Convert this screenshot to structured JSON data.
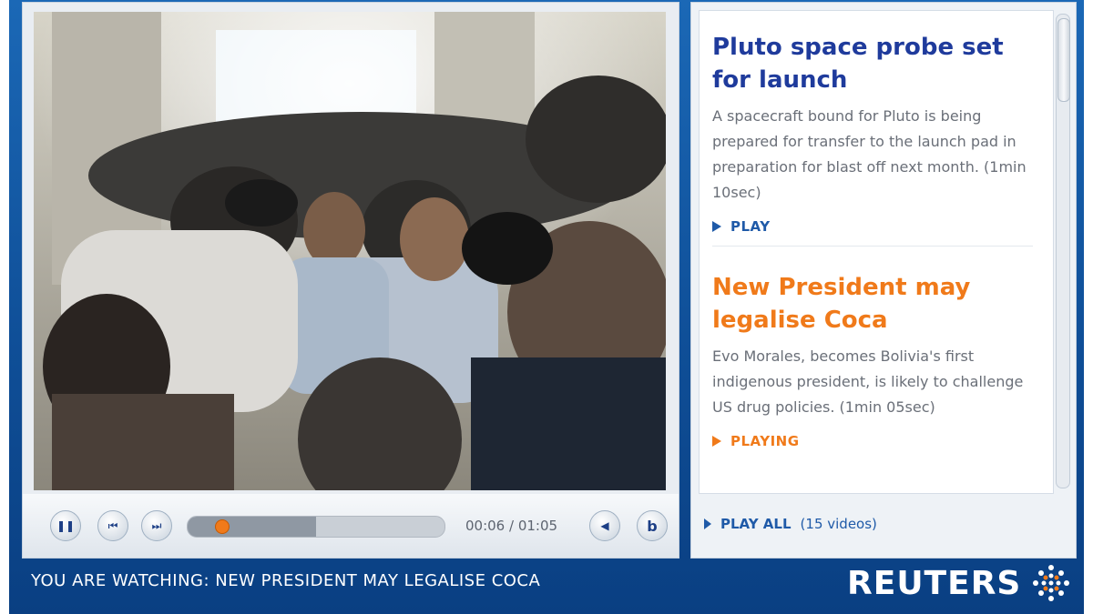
{
  "player": {
    "controls": {
      "pause": {
        "icon": "pause-icon",
        "glyph": "❚❚"
      },
      "prev": {
        "icon": "previous-icon",
        "glyph": "⏮"
      },
      "next": {
        "icon": "next-icon",
        "glyph": "⏭"
      },
      "volume": {
        "icon": "speaker-icon",
        "glyph": "◀"
      },
      "share": {
        "icon": "share-icon",
        "glyph": "b"
      }
    },
    "progress_fraction": 0.13,
    "buffered_fraction": 0.5,
    "time_display": "00:06 / 01:05"
  },
  "playlist": {
    "items": [
      {
        "title": "Pluto space probe set for launch",
        "description": "A spacecraft bound for Pluto is being prepared for transfer to the launch pad in preparation for blast off next month.  (1min 10sec)",
        "action": "PLAY",
        "color": "#1f3b9c"
      },
      {
        "title": "New President may legalise Coca",
        "description": "Evo Morales, becomes Bolivia's first indigenous president, is likely to challenge US drug policies.  (1min 05sec)",
        "action": "PLAYING",
        "color": "#f07a1a"
      }
    ],
    "play_all_label": "PLAY ALL",
    "play_all_count": "(15 videos)"
  },
  "now_watching": "YOU ARE WATCHING: NEW PRESIDENT MAY LEGALISE COCA",
  "brand": {
    "name": "REUTERS",
    "logo_icon": "reuters-dot-globe-icon"
  },
  "colors": {
    "accent_blue": "#1f3b9c",
    "accent_orange": "#f07a1a",
    "bar_blue": "#1b68b6"
  }
}
